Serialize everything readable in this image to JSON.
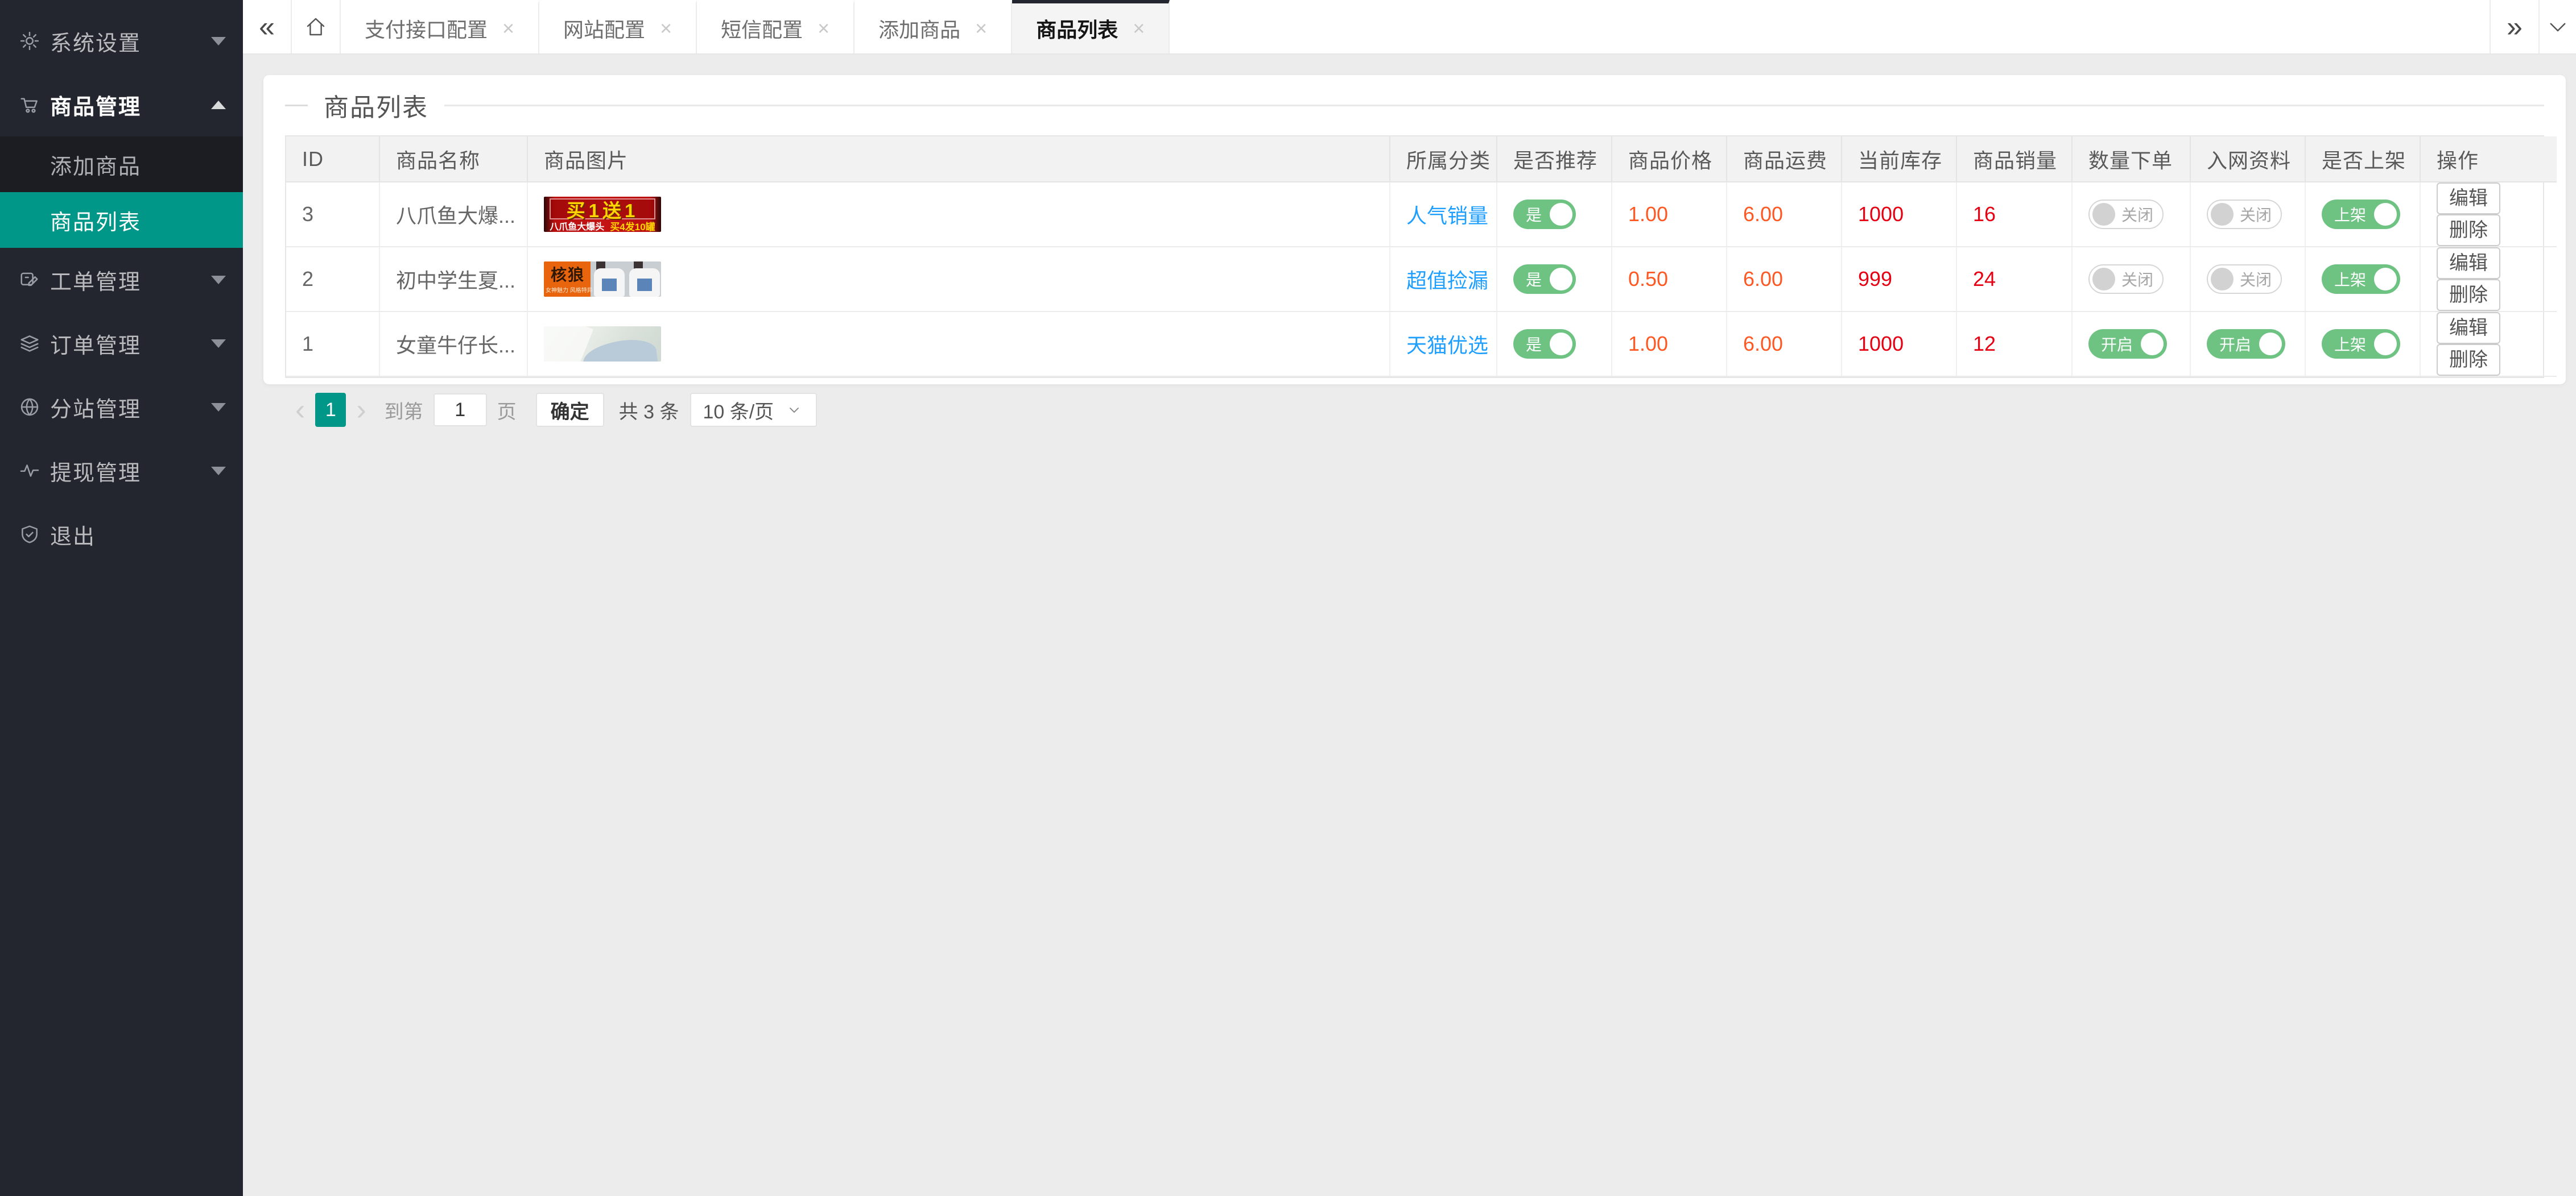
{
  "sidebar": {
    "items": [
      {
        "name": "system-settings",
        "label": "系统设置",
        "type": "top",
        "icon": "gear-icon",
        "chevron": "down",
        "expanded": false
      },
      {
        "name": "product-management",
        "label": "商品管理",
        "type": "top",
        "icon": "cart-icon",
        "chevron": "up",
        "expanded": true
      },
      {
        "name": "add-product",
        "label": "添加商品",
        "type": "sub",
        "active": false
      },
      {
        "name": "product-list",
        "label": "商品列表",
        "type": "sub",
        "active": true
      },
      {
        "name": "work-order-management",
        "label": "工单管理",
        "type": "top",
        "icon": "ticket-icon",
        "chevron": "down",
        "expanded": false
      },
      {
        "name": "order-management",
        "label": "订单管理",
        "type": "top",
        "icon": "layers-icon",
        "chevron": "down",
        "expanded": false
      },
      {
        "name": "substation-management",
        "label": "分站管理",
        "type": "top",
        "icon": "globe-icon",
        "chevron": "down",
        "expanded": false
      },
      {
        "name": "withdrawal-management",
        "label": "提现管理",
        "type": "top",
        "icon": "pulse-icon",
        "chevron": "down",
        "expanded": false
      },
      {
        "name": "logout",
        "label": "退出",
        "type": "top",
        "icon": "shield-icon",
        "chevron": "none",
        "expanded": false
      }
    ]
  },
  "tabbar": {
    "collapse_glyph": "«",
    "overflow_glyph": "»",
    "close_glyph": "×",
    "tabs": [
      {
        "name": "payment-api-config",
        "label": "支付接口配置",
        "active": false
      },
      {
        "name": "site-config",
        "label": "网站配置",
        "active": false
      },
      {
        "name": "sms-config",
        "label": "短信配置",
        "active": false
      },
      {
        "name": "add-product",
        "label": "添加商品",
        "active": false
      },
      {
        "name": "product-list",
        "label": "商品列表",
        "active": true
      }
    ]
  },
  "panel": {
    "title": "商品列表"
  },
  "table": {
    "columns": [
      "ID",
      "商品名称",
      "商品图片",
      "所属分类",
      "是否推荐",
      "商品价格",
      "商品运费",
      "当前库存",
      "商品销量",
      "数量下单",
      "入网资料",
      "是否上架",
      "操作"
    ],
    "rows": [
      {
        "id": "3",
        "name": "八爪鱼大爆...",
        "image": {
          "kind": "promo",
          "line1": "买1送1",
          "line2a": "八爪鱼大爆头",
          "line2b": "买4发10罐"
        },
        "category": "人气销量",
        "recommended": {
          "label": "是",
          "state": "on"
        },
        "price": "1.00",
        "shipping": "6.00",
        "stock": "1000",
        "sales": "16",
        "quantity_order": {
          "label": "关闭",
          "state": "off"
        },
        "network_info": {
          "label": "关闭",
          "state": "off"
        },
        "listed": {
          "label": "上架",
          "state": "on"
        },
        "edit_label": "编辑",
        "delete_label": "删除"
      },
      {
        "id": "2",
        "name": "初中学生夏...",
        "image": {
          "kind": "tshirt",
          "badge": "核狼",
          "tagline": "女神魅力 风格特异"
        },
        "category": "超值捡漏",
        "recommended": {
          "label": "是",
          "state": "on"
        },
        "price": "0.50",
        "shipping": "6.00",
        "stock": "999",
        "sales": "24",
        "quantity_order": {
          "label": "关闭",
          "state": "off"
        },
        "network_info": {
          "label": "关闭",
          "state": "off"
        },
        "listed": {
          "label": "上架",
          "state": "on"
        },
        "edit_label": "编辑",
        "delete_label": "删除"
      },
      {
        "id": "1",
        "name": "女童牛仔长...",
        "image": {
          "kind": "jeans"
        },
        "category": "天猫优选",
        "recommended": {
          "label": "是",
          "state": "on"
        },
        "price": "1.00",
        "shipping": "6.00",
        "stock": "1000",
        "sales": "12",
        "quantity_order": {
          "label": "开启",
          "state": "on"
        },
        "network_info": {
          "label": "开启",
          "state": "on"
        },
        "listed": {
          "label": "上架",
          "state": "on"
        },
        "edit_label": "编辑",
        "delete_label": "删除"
      }
    ]
  },
  "pagination": {
    "prev_glyph": "‹",
    "next_glyph": "›",
    "current_page": "1",
    "goto_prefix": "到第",
    "goto_value": "1",
    "goto_suffix": "页",
    "confirm_label": "确定",
    "total_label": "共 3 条",
    "page_size": "10 条/页"
  },
  "colors": {
    "accent_teal": "#009688",
    "toggle_green": "#6ec383",
    "link_blue": "#1E9FFF",
    "price_orange": "#FF5722",
    "stock_red": "#E60012",
    "sidebar_bg": "#23262E"
  }
}
